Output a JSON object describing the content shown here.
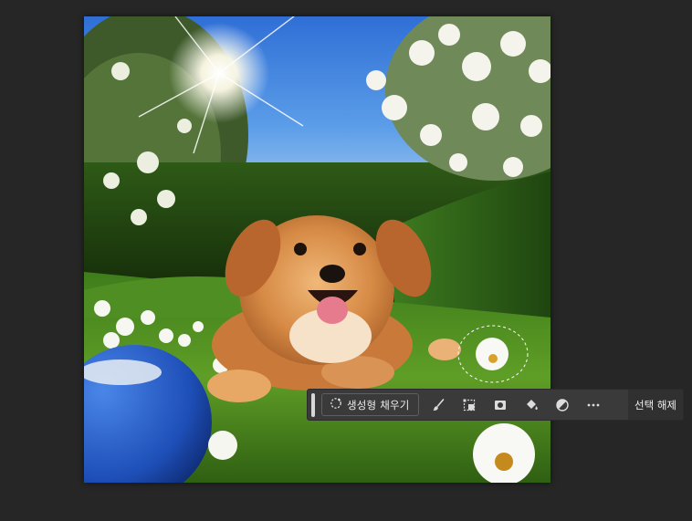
{
  "image": {
    "description_icon": "puppy-photo"
  },
  "context_bar": {
    "generative_fill_label": "생성형 채우기",
    "deselect_label": "선택 해제",
    "tools": [
      {
        "name": "brush-icon"
      },
      {
        "name": "transform-selection-icon"
      },
      {
        "name": "mask-icon"
      },
      {
        "name": "fill-bucket-icon"
      },
      {
        "name": "adjustment-icon"
      },
      {
        "name": "more-options-icon"
      }
    ]
  },
  "colors": {
    "workspace_bg": "#262626",
    "toolbar_bg": "#3a3a3a",
    "toolbar_text": "#ececec"
  }
}
